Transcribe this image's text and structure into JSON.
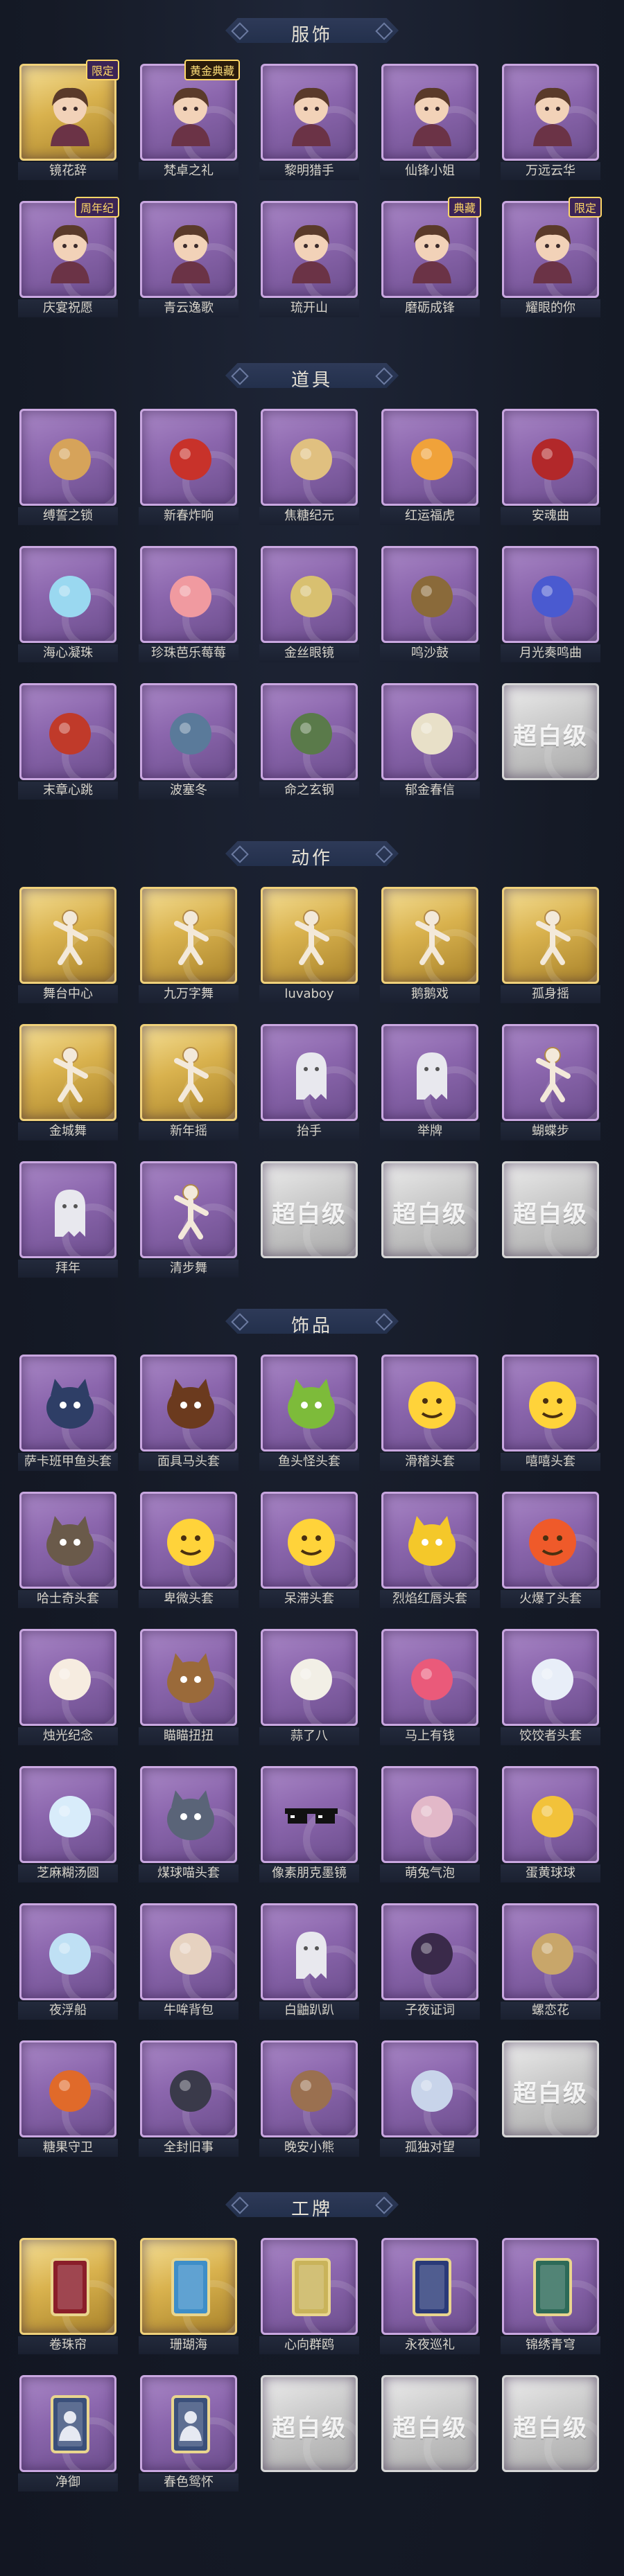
{
  "sections": {
    "clothing": {
      "title": "服饰",
      "items": [
        {
          "label": "镜花辞",
          "badge": "限定",
          "frame": "gold",
          "icon": "red-hood-portrait-icon"
        },
        {
          "label": "梵卓之礼",
          "badge": "黄金典藏",
          "frame": "purple",
          "icon": "vampire-portrait-icon"
        },
        {
          "label": "黎明猎手",
          "frame": "purple",
          "icon": "hunter-portrait-icon"
        },
        {
          "label": "仙锋小姐",
          "frame": "purple",
          "icon": "lady-portrait-icon"
        },
        {
          "label": "万远云华",
          "frame": "purple",
          "icon": "silver-hair-portrait-icon"
        },
        {
          "label": "庆宴祝愿",
          "badge": "周年纪",
          "frame": "purple",
          "icon": "party-girl-portrait-icon"
        },
        {
          "label": "青云逸歌",
          "frame": "purple",
          "icon": "blue-hair-portrait-icon"
        },
        {
          "label": "琉开山",
          "frame": "purple",
          "icon": "warrior-portrait-icon"
        },
        {
          "label": "磨砺成锋",
          "badge": "典藏",
          "frame": "purple",
          "icon": "blade-portrait-icon"
        },
        {
          "label": "耀眼的你",
          "badge": "限定",
          "frame": "purple",
          "icon": "hat-lady-portrait-icon"
        }
      ]
    },
    "props": {
      "title": "道具",
      "items": [
        {
          "label": "缚誓之锁",
          "frame": "purple",
          "icon": "chain-icon"
        },
        {
          "label": "新春炸响",
          "frame": "purple",
          "icon": "firecracker-icon"
        },
        {
          "label": "焦糖纪元",
          "frame": "purple",
          "icon": "candy-stick-icon"
        },
        {
          "label": "红运福虎",
          "frame": "purple",
          "icon": "tiger-icon"
        },
        {
          "label": "安魂曲",
          "frame": "purple",
          "icon": "dagger-icon"
        },
        {
          "label": "海心凝珠",
          "frame": "purple",
          "icon": "shell-pearl-icon"
        },
        {
          "label": "珍珠芭乐莓莓",
          "frame": "purple",
          "icon": "drink-icon"
        },
        {
          "label": "金丝眼镜",
          "frame": "purple",
          "icon": "glasses-icon"
        },
        {
          "label": "鸣沙鼓",
          "frame": "purple",
          "icon": "drum-icon"
        },
        {
          "label": "月光奏鸣曲",
          "frame": "purple",
          "icon": "piano-icon"
        },
        {
          "label": "末章心跳",
          "frame": "purple",
          "icon": "staff-icon"
        },
        {
          "label": "波塞冬",
          "frame": "purple",
          "icon": "trident-icon"
        },
        {
          "label": "命之玄钢",
          "frame": "purple",
          "icon": "grenade-icon"
        },
        {
          "label": "郁金春信",
          "frame": "purple",
          "icon": "fan-icon"
        },
        {
          "label": "",
          "frame": "gray",
          "icon": "placeholder-icon",
          "placeholder": "超白级"
        }
      ]
    },
    "actions": {
      "title": "动作",
      "items": [
        {
          "label": "舞台中心",
          "frame": "gold",
          "icon": "dance-pose-icon"
        },
        {
          "label": "九万字舞",
          "frame": "gold",
          "icon": "dance-pose-icon"
        },
        {
          "label": "luvaboy",
          "frame": "gold",
          "icon": "dance-pose-icon"
        },
        {
          "label": "鹅鹅戏",
          "frame": "gold",
          "icon": "dance-pose-icon"
        },
        {
          "label": "孤身摇",
          "frame": "gold",
          "icon": "dance-pose-icon"
        },
        {
          "label": "金城舞",
          "frame": "gold",
          "icon": "dance-pose-icon"
        },
        {
          "label": "新年摇",
          "frame": "gold",
          "icon": "dance-pose-icon"
        },
        {
          "label": "抬手",
          "frame": "purple",
          "icon": "ghost-pose-icon"
        },
        {
          "label": "举牌",
          "frame": "purple",
          "icon": "sign-pose-icon"
        },
        {
          "label": "蝴蝶步",
          "frame": "purple",
          "icon": "dance-pose-icon"
        },
        {
          "label": "拜年",
          "frame": "purple",
          "icon": "ghost-pose-icon"
        },
        {
          "label": "清步舞",
          "frame": "purple",
          "icon": "dance-pose-icon"
        },
        {
          "label": "",
          "frame": "gray",
          "icon": "placeholder-icon",
          "placeholder": "超白级"
        },
        {
          "label": "",
          "frame": "gray",
          "icon": "placeholder-icon",
          "placeholder": "超白级"
        },
        {
          "label": "",
          "frame": "gray",
          "icon": "placeholder-icon",
          "placeholder": "超白级"
        }
      ]
    },
    "accessories": {
      "title": "饰品",
      "items": [
        {
          "label": "萨卡班甲鱼头套",
          "frame": "purple",
          "icon": "fish-head-icon"
        },
        {
          "label": "面具马头套",
          "frame": "purple",
          "icon": "horse-head-icon"
        },
        {
          "label": "鱼头怪头套",
          "frame": "purple",
          "icon": "frog-head-icon"
        },
        {
          "label": "滑稽头套",
          "frame": "purple",
          "icon": "smirk-face-icon"
        },
        {
          "label": "嘻嘻头套",
          "frame": "purple",
          "icon": "grin-face-icon"
        },
        {
          "label": "哈士奇头套",
          "frame": "purple",
          "icon": "husky-head-icon"
        },
        {
          "label": "卑微头套",
          "frame": "purple",
          "icon": "sad-face-icon"
        },
        {
          "label": "呆滞头套",
          "frame": "purple",
          "icon": "dazed-face-icon"
        },
        {
          "label": "烈焰红唇头套",
          "frame": "purple",
          "icon": "pikachu-head-icon"
        },
        {
          "label": "火爆了头套",
          "frame": "purple",
          "icon": "fire-face-icon"
        },
        {
          "label": "烛光纪念",
          "frame": "purple",
          "icon": "candle-icon"
        },
        {
          "label": "瞄瞄扭扭",
          "frame": "purple",
          "icon": "dog-head-icon"
        },
        {
          "label": "蒜了八",
          "frame": "purple",
          "icon": "garlic-icon"
        },
        {
          "label": "马上有钱",
          "frame": "purple",
          "icon": "flamingo-icon"
        },
        {
          "label": "饺饺者头套",
          "frame": "purple",
          "icon": "dumpling-icon"
        },
        {
          "label": "芝麻糊汤圆",
          "frame": "purple",
          "icon": "mochi-icon"
        },
        {
          "label": "煤球喵头套",
          "frame": "purple",
          "icon": "cat-head-icon"
        },
        {
          "label": "像素朋克墨镜",
          "frame": "purple",
          "icon": "pixel-sunglasses-icon"
        },
        {
          "label": "萌兔气泡",
          "frame": "purple",
          "icon": "bunny-bubble-icon"
        },
        {
          "label": "蛋黄球球",
          "frame": "purple",
          "icon": "chick-icon"
        },
        {
          "label": "夜浮船",
          "frame": "purple",
          "icon": "crystal-icon"
        },
        {
          "label": "牛哞背包",
          "frame": "purple",
          "icon": "cow-bag-icon"
        },
        {
          "label": "白鼬趴趴",
          "frame": "purple",
          "icon": "ghost-pet-icon"
        },
        {
          "label": "子夜证词",
          "frame": "purple",
          "icon": "winged-figure-icon"
        },
        {
          "label": "螺恋花",
          "frame": "purple",
          "icon": "ornament-icon"
        },
        {
          "label": "糖果守卫",
          "frame": "purple",
          "icon": "lantern-icon"
        },
        {
          "label": "全封旧事",
          "frame": "purple",
          "icon": "chibi-figure-icon"
        },
        {
          "label": "晚安小熊",
          "frame": "purple",
          "icon": "bear-figure-icon"
        },
        {
          "label": "孤独对望",
          "frame": "purple",
          "icon": "doll-figure-icon"
        },
        {
          "label": "",
          "frame": "gray",
          "icon": "placeholder-icon",
          "placeholder": "超白级"
        }
      ]
    },
    "cards": {
      "title": "工牌",
      "items": [
        {
          "label": "卷珠帘",
          "frame": "gold",
          "icon": "card-red-icon"
        },
        {
          "label": "珊瑚海",
          "frame": "gold",
          "icon": "card-blue-icon"
        },
        {
          "label": "心向群鸥",
          "frame": "purple",
          "icon": "card-gold-icon"
        },
        {
          "label": "永夜巡礼",
          "frame": "purple",
          "icon": "card-night-icon"
        },
        {
          "label": "锦绣青穹",
          "frame": "purple",
          "icon": "card-green-icon"
        },
        {
          "label": "净御",
          "frame": "purple",
          "icon": "card-silhouette-icon"
        },
        {
          "label": "春色鸳怀",
          "frame": "purple",
          "icon": "card-silhouette-icon"
        },
        {
          "label": "",
          "frame": "gray",
          "icon": "placeholder-icon",
          "placeholder": "超白级"
        },
        {
          "label": "",
          "frame": "gray",
          "icon": "placeholder-icon",
          "placeholder": "超白级"
        },
        {
          "label": "",
          "frame": "gray",
          "icon": "placeholder-icon",
          "placeholder": "超白级"
        }
      ]
    }
  }
}
